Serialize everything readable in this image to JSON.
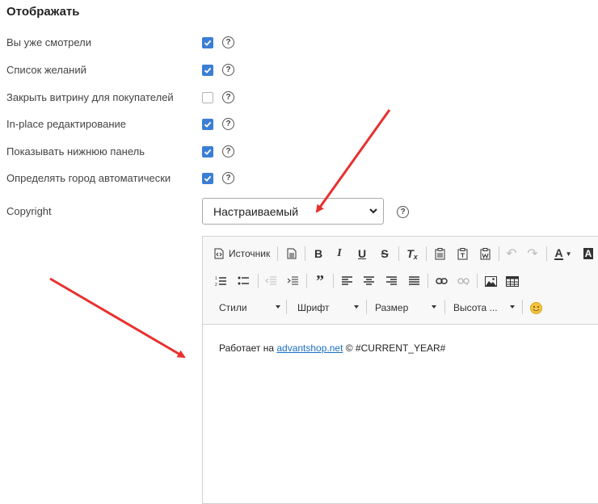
{
  "section_title": "Отображать",
  "settings": [
    {
      "label": "Вы уже смотрели",
      "checked": true
    },
    {
      "label": "Список желаний",
      "checked": true
    },
    {
      "label": "Закрыть витрину для покупателей",
      "checked": false
    },
    {
      "label": "In-place редактирование",
      "checked": true
    },
    {
      "label": "Показывать нижнюю панель",
      "checked": true
    },
    {
      "label": "Определять город автоматически",
      "checked": true
    }
  ],
  "copyright": {
    "label": "Copyright",
    "selected": "Настраиваемый"
  },
  "editor": {
    "source_label": "Источник",
    "combos": {
      "styles": "Стили",
      "font": "Шрифт",
      "size": "Размер",
      "height": "Высота ..."
    },
    "content": {
      "prefix": "Работает на ",
      "link": "advantshop.net",
      "suffix": " © #CURRENT_YEAR#"
    }
  },
  "colors": {
    "accent": "#3b7ed6",
    "arrow": "#e8302f",
    "link": "#1a6fc4"
  }
}
